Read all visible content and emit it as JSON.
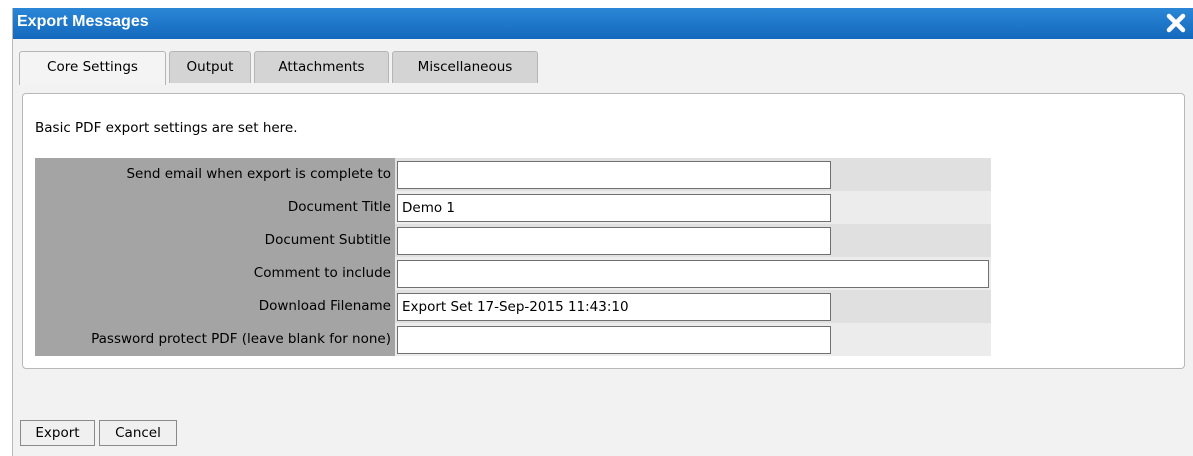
{
  "dialog": {
    "title": "Export Messages",
    "close_icon": "close-icon"
  },
  "tabs": [
    {
      "label": "Core Settings",
      "active": true
    },
    {
      "label": "Output",
      "active": false
    },
    {
      "label": "Attachments",
      "active": false
    },
    {
      "label": "Miscellaneous",
      "active": false
    }
  ],
  "panel": {
    "intro": "Basic PDF export settings are set here.",
    "fields": [
      {
        "label": "Send email when export is complete to",
        "value": ""
      },
      {
        "label": "Document Title",
        "value": "Demo 1"
      },
      {
        "label": "Document Subtitle",
        "value": ""
      },
      {
        "label": "Comment to include",
        "value": ""
      },
      {
        "label": "Download Filename",
        "value": "Export Set 17-Sep-2015 11:43:10"
      },
      {
        "label": "Password protect PDF (leave blank for none)",
        "value": ""
      }
    ]
  },
  "buttons": {
    "export": "Export",
    "cancel": "Cancel"
  },
  "colors": {
    "titlebar": "#1a73c7",
    "label_background": "#a4a4a4",
    "active_tab": "#f4f4f4",
    "inactive_tab": "#d4d4d4"
  }
}
